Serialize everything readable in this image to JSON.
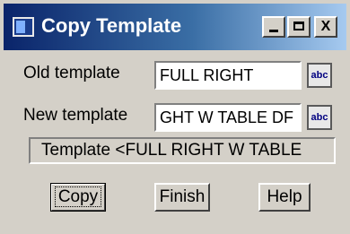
{
  "window": {
    "title": "Copy Template",
    "controls": {
      "minimize": "_",
      "maximize": "□",
      "close": "X"
    }
  },
  "form": {
    "old_template_label": "Old template",
    "old_template_value": "FULL RIGHT",
    "new_template_label": "New template",
    "new_template_value": "GHT W TABLE DF",
    "browse_glyph": "abc"
  },
  "status": {
    "text": "Template <FULL RIGHT W TABLE"
  },
  "buttons": {
    "copy": "Copy",
    "finish": "Finish",
    "help": "Help"
  }
}
